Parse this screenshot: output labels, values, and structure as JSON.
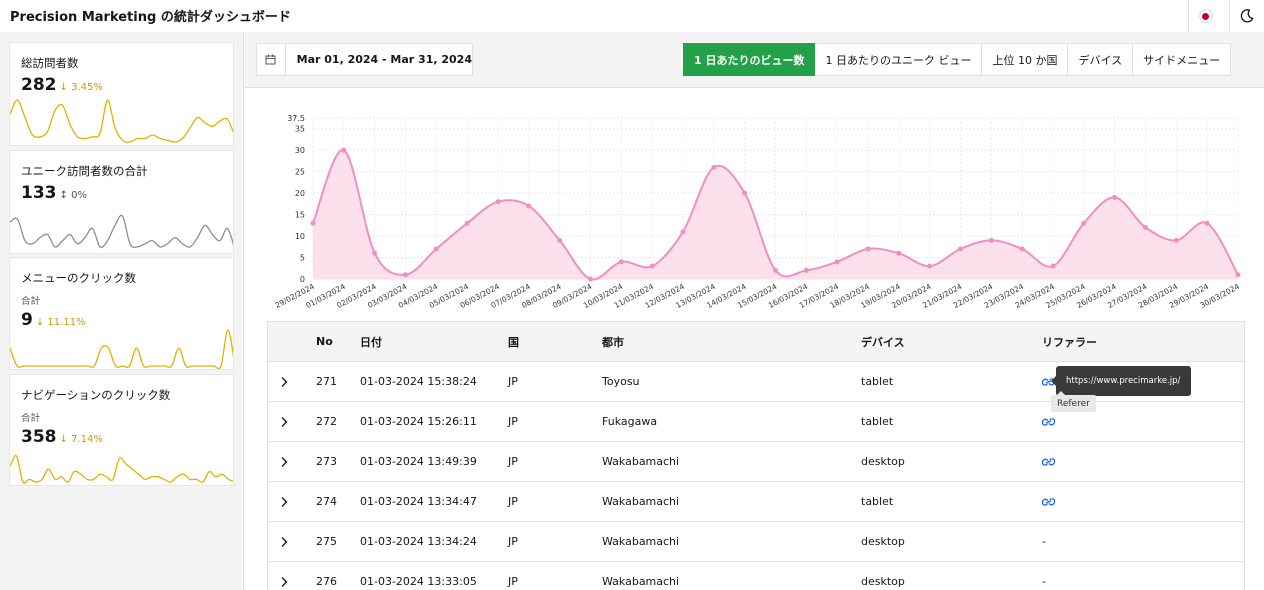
{
  "app": {
    "title": "Precision Marketing の統計ダッシュボード"
  },
  "cards": [
    {
      "title": "総訪問者数",
      "subtitle": "",
      "value": "282",
      "delta": "3.45%",
      "delta_dir": "down",
      "spark_color": "#e5b000",
      "spark": [
        20,
        28,
        18,
        8,
        7,
        10,
        22,
        25,
        14,
        7,
        6,
        7,
        9,
        28,
        12,
        5,
        4,
        6,
        6,
        8,
        6,
        5,
        4,
        6,
        12,
        18,
        15,
        13,
        16,
        17,
        7
      ]
    },
    {
      "title": "ユニーク訪問者数の合計",
      "subtitle": "",
      "value": "133",
      "delta": "0%",
      "delta_dir": "neutral",
      "spark_color": "#8d8d8d",
      "spark": [
        14,
        15,
        8,
        7,
        9,
        10,
        6,
        8,
        10,
        7,
        9,
        12,
        6,
        8,
        13,
        16,
        7,
        6,
        7,
        8,
        6,
        7,
        9,
        7,
        6,
        9,
        13,
        10,
        8,
        12,
        5
      ]
    },
    {
      "title": "メニューのクリック数",
      "subtitle": "合計",
      "value": "9",
      "delta": "11.11%",
      "delta_dir": "down",
      "spark_color": "#e5b000",
      "spark": [
        1,
        0,
        0,
        0,
        0,
        0,
        0,
        0,
        0,
        0,
        0,
        0,
        0,
        1,
        1,
        0,
        0,
        0,
        1,
        0,
        0,
        0,
        0,
        0,
        1,
        0,
        0,
        0,
        0,
        0,
        0,
        2,
        0
      ]
    },
    {
      "title": "ナビゲーションのクリック数",
      "subtitle": "合計",
      "value": "358",
      "delta": "7.14%",
      "delta_dir": "down",
      "spark_color": "#e5b000",
      "spark": [
        9,
        13,
        3,
        4,
        3,
        4,
        8,
        4,
        5,
        3,
        7,
        6,
        4,
        4,
        6,
        5,
        4,
        12,
        10,
        8,
        6,
        4,
        5,
        5,
        4,
        3,
        5,
        6,
        4,
        4,
        3,
        7,
        5,
        6,
        4,
        3
      ]
    }
  ],
  "date_range": "Mar 01, 2024 - Mar 31, 2024",
  "tabs": [
    {
      "label": "1 日あたりのビュー数",
      "active": true
    },
    {
      "label": "1 日あたりのユニーク ビュー",
      "active": false
    },
    {
      "label": "上位 10 か国",
      "active": false
    },
    {
      "label": "デバイス",
      "active": false
    },
    {
      "label": "サイドメニュー",
      "active": false
    }
  ],
  "chart_data": {
    "type": "area",
    "x": [
      "29/02/2024",
      "01/03/2024",
      "02/03/2024",
      "03/03/2024",
      "04/03/2024",
      "05/03/2024",
      "06/03/2024",
      "07/03/2024",
      "08/03/2024",
      "09/03/2024",
      "10/03/2024",
      "11/03/2024",
      "12/03/2024",
      "13/03/2024",
      "14/03/2024",
      "15/03/2024",
      "16/03/2024",
      "17/03/2024",
      "18/03/2024",
      "19/03/2024",
      "20/03/2024",
      "21/03/2024",
      "22/03/2024",
      "23/03/2024",
      "24/03/2024",
      "25/03/2024",
      "26/03/2024",
      "27/03/2024",
      "28/03/2024",
      "29/03/2024",
      "30/03/2024"
    ],
    "series": [
      {
        "values": [
          13,
          30,
          6,
          1,
          7,
          13,
          18,
          17,
          9,
          0,
          4,
          3,
          11,
          26,
          20,
          2,
          2,
          4,
          7,
          6,
          3,
          7,
          9,
          7,
          3,
          13,
          19,
          12,
          9,
          13,
          1
        ]
      }
    ],
    "y_ticks": [
      "0",
      "5",
      "10",
      "15",
      "20",
      "25",
      "30",
      "35",
      "37.5"
    ],
    "ylim": [
      0,
      37.5
    ],
    "grid": true,
    "line_color": "#f08fc0",
    "fill_color": "#fbd5e6",
    "title": "",
    "xlabel": "",
    "ylabel": ""
  },
  "table": {
    "headers": [
      "No",
      "日付",
      "国",
      "都市",
      "デバイス",
      "リファラー"
    ],
    "rows": [
      {
        "no": "271",
        "date": "01-03-2024 15:38:24",
        "country": "JP",
        "city": "Toyosu",
        "device": "tablet",
        "referrer": "link"
      },
      {
        "no": "272",
        "date": "01-03-2024 15:26:11",
        "country": "JP",
        "city": "Fukagawa",
        "device": "tablet",
        "referrer": "link"
      },
      {
        "no": "273",
        "date": "01-03-2024 13:49:39",
        "country": "JP",
        "city": "Wakabamachi",
        "device": "desktop",
        "referrer": "link"
      },
      {
        "no": "274",
        "date": "01-03-2024 13:34:47",
        "country": "JP",
        "city": "Wakabamachi",
        "device": "tablet",
        "referrer": "link"
      },
      {
        "no": "275",
        "date": "01-03-2024 13:34:24",
        "country": "JP",
        "city": "Wakabamachi",
        "device": "desktop",
        "referrer": "-"
      },
      {
        "no": "276",
        "date": "01-03-2024 13:33:05",
        "country": "JP",
        "city": "Wakabamachi",
        "device": "desktop",
        "referrer": "-"
      }
    ]
  },
  "tooltip": {
    "url": "https://www.precimarke.jp/",
    "label": "Referer"
  },
  "colors": {
    "accent": "#24a148",
    "link": "#0f62fe"
  }
}
